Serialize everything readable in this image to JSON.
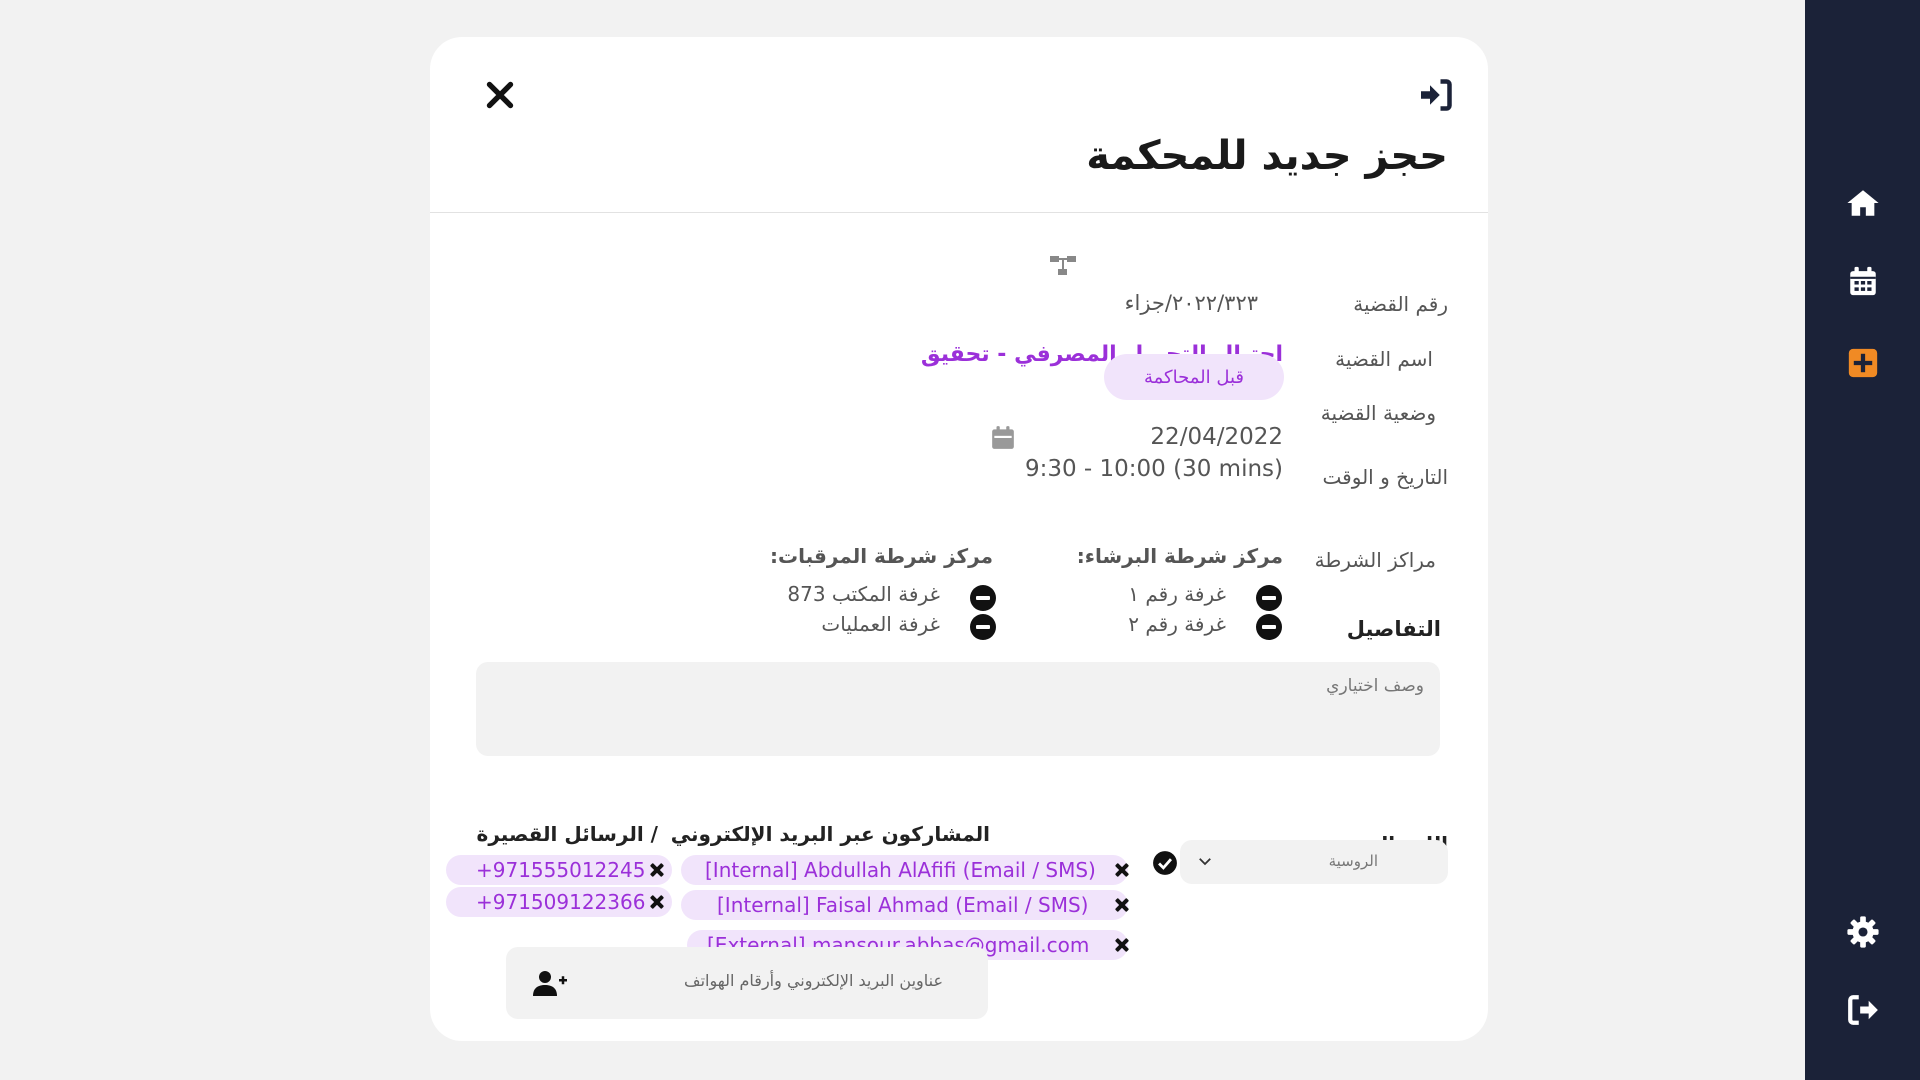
{
  "modal": {
    "title": "حجز جديد للمحكمة"
  },
  "fields": {
    "case_number_label": "رقم القضية",
    "case_number_value": "٢٠٢٢/٣٢٣/جزاء",
    "case_name_label": "اسم القضية",
    "case_name_value": "احتيال التحويل المصرفي - تحقيق",
    "case_status_label": "وضعية القضية",
    "case_status_value": "قبل المحاكمة",
    "datetime_label": "التاريخ و الوقت",
    "date_value": "22/04/2022",
    "time_value": "9:30 - 10:00 (30 mins)",
    "police_label": "مراكز الشرطة"
  },
  "police_stations": [
    {
      "name": "مركز شرطة البرشاء:",
      "rooms": [
        "غرفة رقم ١",
        "غرفة رقم ٢"
      ]
    },
    {
      "name": "مركز شرطة المرقبات:",
      "rooms": [
        "غرفة المكتب 873",
        "غرفة العمليات"
      ]
    }
  ],
  "details": {
    "label": "التفاصيل",
    "placeholder": "وصف اختياري"
  },
  "language": {
    "label": "اللغة المترجمة",
    "selected": "الروسية"
  },
  "participants": {
    "email_label": "المشاركون عبر البريد الإلكتروني",
    "sms_label": "/ الرسائل القصيرة",
    "emails": [
      "[Internal] Abdullah AlAfifi (Email / SMS)",
      "[Internal] Faisal Ahmad (Email / SMS)",
      "[External] mansour.abbas@gmail.com"
    ],
    "phones": [
      "+971555012245",
      "+971509122366"
    ],
    "add_placeholder": "عناوين البريد الإلكتروني وأرقام الهواتف"
  },
  "colors": {
    "sidebar": "#1b2238",
    "accent_purple": "#9b30d9",
    "chip_bg": "#f1e4fb",
    "accent_orange": "#f08a24"
  },
  "icons": {
    "sidebar": [
      "home-icon",
      "calendar-icon",
      "add-booking-icon",
      "settings-icon",
      "logout-icon"
    ],
    "header": [
      "close-icon",
      "login-icon"
    ]
  }
}
